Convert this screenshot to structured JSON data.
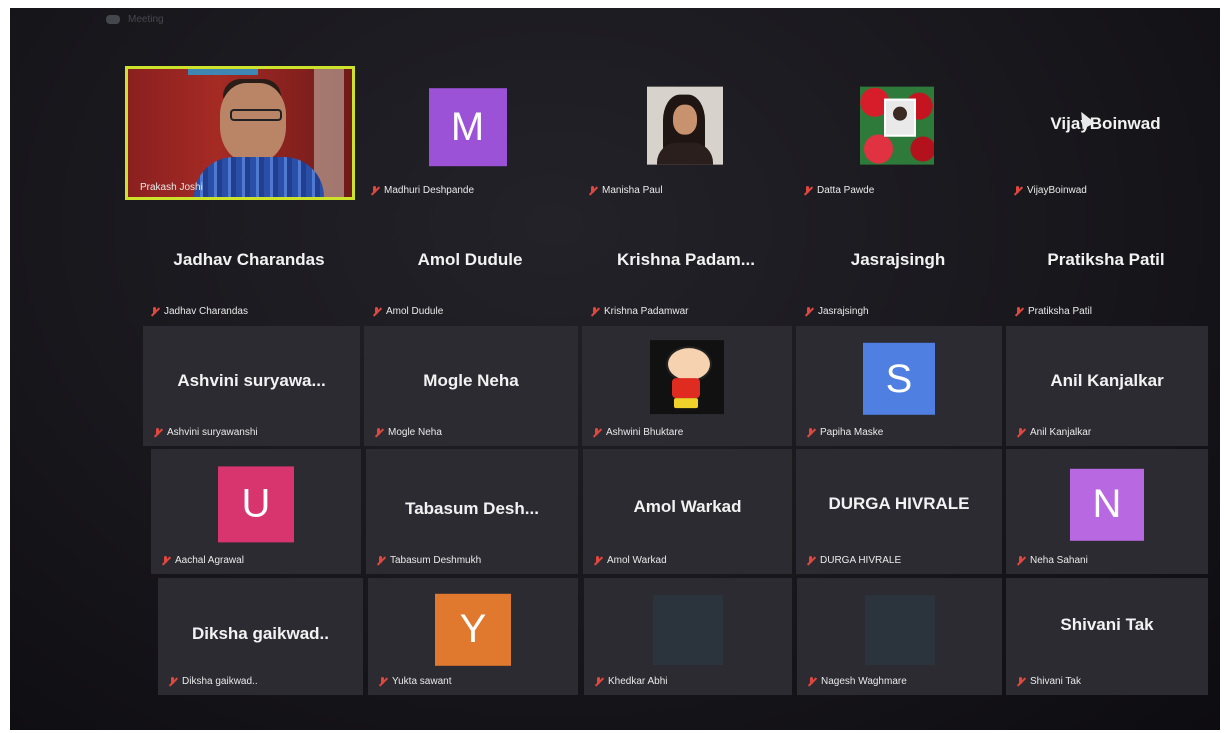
{
  "window": {
    "title": "Meeting"
  },
  "colors": {
    "active_speaker_border": "#cde22a",
    "muted_icon": "#e0473f"
  },
  "participants": [
    {
      "name": "Prakash Joshi",
      "video_on": true,
      "active_speaker": true
    },
    {
      "label": "Madhuri Deshpande",
      "avatar_letter": "M",
      "avatar_color": "#9b52d6",
      "muted": true
    },
    {
      "label": "Manisha Paul",
      "muted": true,
      "picture": "profile-photo"
    },
    {
      "label": "Datta Pawde",
      "muted": true,
      "picture": "profile-photo"
    },
    {
      "display": "VijayBoinwad",
      "label": "VijayBoinwad",
      "muted": true
    },
    {
      "display": "Jadhav Charandas",
      "label": "Jadhav Charandas",
      "muted": true
    },
    {
      "display": "Amol Dudule",
      "label": "Amol Dudule",
      "muted": true
    },
    {
      "display": "Krishna  Padam...",
      "label": "Krishna Padamwar",
      "muted": true
    },
    {
      "display": "Jasrajsingh",
      "label": "Jasrajsingh",
      "muted": true
    },
    {
      "display": "Pratiksha Patil",
      "label": "Pratiksha Patil",
      "muted": true
    },
    {
      "display": "Ashvini  suryawa...",
      "label": "Ashvini suryawanshi",
      "muted": true
    },
    {
      "display": "Mogle Neha",
      "label": "Mogle Neha",
      "muted": true
    },
    {
      "label": "Ashwini Bhuktare",
      "muted": true,
      "picture": "cartoon-avatar"
    },
    {
      "label": "Papiha Maske",
      "avatar_letter": "S",
      "avatar_color": "#4f7fe0",
      "muted": true
    },
    {
      "display": "Anil Kanjalkar",
      "label": "Anil Kanjalkar",
      "muted": true
    },
    {
      "label": "Aachal Agrawal",
      "avatar_letter": "U",
      "avatar_color": "#d8346e",
      "muted": true
    },
    {
      "display": "Tabasum  Desh...",
      "label": "Tabasum Deshmukh",
      "muted": true
    },
    {
      "display": "Amol Warkad",
      "label": "Amol Warkad",
      "muted": true
    },
    {
      "display": "DURGA HIVRALE",
      "label": "DURGA HIVRALE",
      "muted": true
    },
    {
      "label": "Neha Sahani",
      "avatar_letter": "N",
      "avatar_color": "#b868e0",
      "muted": true
    },
    {
      "display": "Diksha gaikwad..",
      "label": "Diksha gaikwad..",
      "muted": true
    },
    {
      "label": "Yukta sawant",
      "avatar_letter": "Y",
      "avatar_color": "#e0782e",
      "muted": true
    },
    {
      "label": "Khedkar Abhi",
      "muted": true,
      "picture": "blank-avatar"
    },
    {
      "label": "Nagesh Waghmare",
      "muted": true,
      "picture": "blank-avatar"
    },
    {
      "display": "Shivani Tak",
      "label": "Shivani Tak",
      "muted": true
    }
  ]
}
